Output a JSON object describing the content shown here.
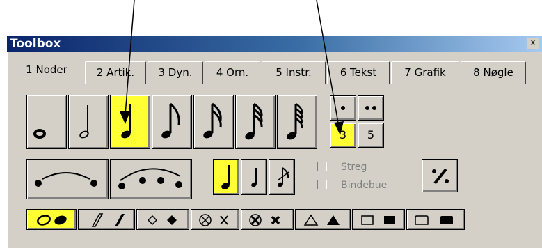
{
  "window": {
    "title": "Toolbox",
    "close_label": "x"
  },
  "tabs": [
    {
      "label": "1 Noder",
      "active": true
    },
    {
      "label": "2 Artik."
    },
    {
      "label": "3 Dyn."
    },
    {
      "label": "4 Orn."
    },
    {
      "label": "5 Instr."
    },
    {
      "label": "6 Tekst"
    },
    {
      "label": "7 Grafik"
    },
    {
      "label": "8 Nøgle"
    }
  ],
  "tuplets": {
    "three": "3",
    "five": "5"
  },
  "options": {
    "streg": "Streg",
    "bindebue": "Bindebue"
  },
  "colors": {
    "highlight": "#ffff33",
    "panel": "#d4d0c8",
    "title_start": "#0a246a"
  },
  "icons": [
    "whole-note-icon",
    "half-note-icon",
    "quarter-note-icon",
    "eighth-note-icon",
    "sixteenth-note-icon",
    "thirty-second-note-icon",
    "sixty-fourth-note-icon"
  ]
}
